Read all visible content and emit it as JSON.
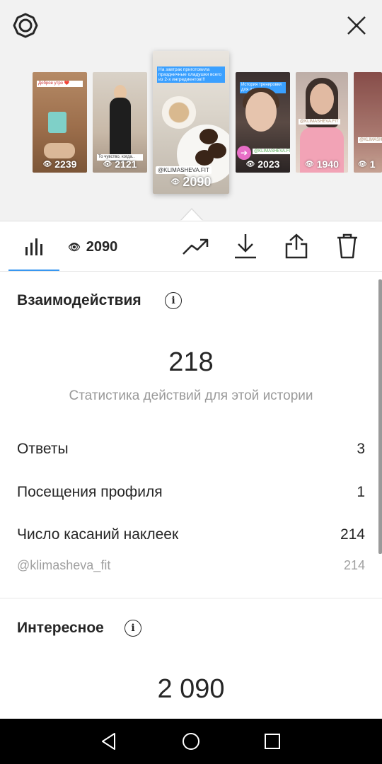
{
  "stories": [
    {
      "views": "2239",
      "sticker_text": "Доброе утро ❤️"
    },
    {
      "views": "2121",
      "sticker_text": "То чувство, когда.."
    },
    {
      "views": "2090",
      "sticker_text": "На завтрак приготовила праздничные оладушки всего из 2-х ингредиентов!!!",
      "tag": "@KLIMASHEVA.FIT"
    },
    {
      "views": "2023",
      "sticker_text": "История тренировки для дам",
      "tag": "@KLIMASHEVA.FIT"
    },
    {
      "views": "1940",
      "tag": "@KLIMASHEVA.FIT"
    },
    {
      "views": "1",
      "tag": "@KLIMASHEVA"
    }
  ],
  "toolbar": {
    "view_count": "2090"
  },
  "interactions": {
    "title": "Взаимодействия",
    "total": "218",
    "subtitle": "Статистика действий для этой истории",
    "rows": [
      {
        "label": "Ответы",
        "value": "3"
      },
      {
        "label": "Посещения профиля",
        "value": "1"
      },
      {
        "label": "Число касаний наклеек",
        "value": "214"
      }
    ],
    "sticker_row": {
      "label": "@klimasheva_fit",
      "value": "214"
    }
  },
  "discovery": {
    "title": "Интересное",
    "total": "2 090"
  },
  "colors": {
    "accent": "#3897f0",
    "text": "#262626",
    "muted": "#999999"
  }
}
